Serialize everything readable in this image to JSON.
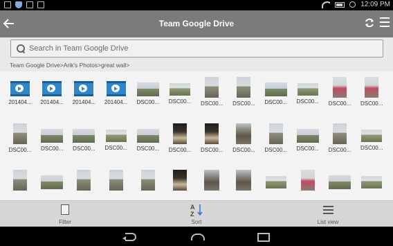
{
  "status_bar": {
    "time": "12:09 PM"
  },
  "header": {
    "title": "Team Google Drive"
  },
  "search": {
    "placeholder": "Search in Team Google Drive"
  },
  "breadcrumb": "Team Google Drive>Arik's Photos>great wall>",
  "rows": [
    [
      {
        "caption": "201404...",
        "kind": "video"
      },
      {
        "caption": "201404...",
        "kind": "video"
      },
      {
        "caption": "201404...",
        "kind": "video"
      },
      {
        "caption": "201404...",
        "kind": "video"
      },
      {
        "caption": "DSC00...",
        "kind": "land"
      },
      {
        "caption": "DSC00...",
        "kind": "land2"
      },
      {
        "caption": "DSC00...",
        "kind": "port"
      },
      {
        "caption": "DSC00...",
        "kind": "port"
      },
      {
        "caption": "DSC00...",
        "kind": "land"
      },
      {
        "caption": "DSC00...",
        "kind": "land2"
      },
      {
        "caption": "DSC00...",
        "kind": "person"
      },
      {
        "caption": "DSC00...",
        "kind": "person"
      }
    ],
    [
      {
        "caption": "DSC00...",
        "kind": "port"
      },
      {
        "caption": "DSC00...",
        "kind": "land"
      },
      {
        "caption": "DSC00...",
        "kind": "land"
      },
      {
        "caption": "DSC00...",
        "kind": "land2"
      },
      {
        "caption": "DSC00...",
        "kind": "land"
      },
      {
        "caption": "DSC00...",
        "kind": "dark"
      },
      {
        "caption": "DSC00...",
        "kind": "dark"
      },
      {
        "caption": "DSC00...",
        "kind": "wall"
      },
      {
        "caption": "DSC00...",
        "kind": "port"
      },
      {
        "caption": "DSC00...",
        "kind": "land"
      },
      {
        "caption": "DSC00...",
        "kind": "port"
      },
      {
        "caption": "DSC00...",
        "kind": "land2"
      }
    ],
    [
      {
        "caption": "",
        "kind": "port"
      },
      {
        "caption": "",
        "kind": "land"
      },
      {
        "caption": "",
        "kind": "port"
      },
      {
        "caption": "",
        "kind": "port"
      },
      {
        "caption": "",
        "kind": "port"
      },
      {
        "caption": "",
        "kind": "dark"
      },
      {
        "caption": "",
        "kind": "wall"
      },
      {
        "caption": "",
        "kind": "wall"
      },
      {
        "caption": "",
        "kind": "land2"
      },
      {
        "caption": "",
        "kind": "person"
      },
      {
        "caption": "",
        "kind": "land"
      },
      {
        "caption": "",
        "kind": "land2"
      }
    ]
  ],
  "toolbar": {
    "filter": "Filter",
    "sort": "Sort",
    "list_view": "List view"
  },
  "icons": [
    "back-arrow-icon",
    "sync-icon",
    "menu-icon",
    "search-icon",
    "filter-icon",
    "sort-az-icon",
    "list-view-icon",
    "nav-back-icon",
    "nav-home-icon",
    "nav-recent-icon"
  ]
}
